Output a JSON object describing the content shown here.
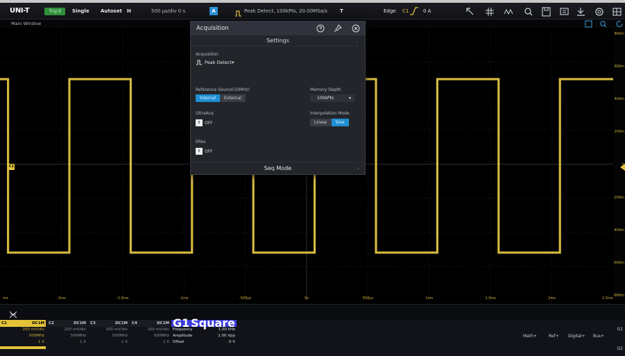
{
  "toolbar": {
    "logo": "UNI-T",
    "state": "Trig'd",
    "run_mode": "Single",
    "autoset": "Autoset",
    "horizontal_badge": "H",
    "timebase": "500 µs/div   0 s",
    "trigger_box": "A",
    "acq_summary": "Peak Detect, 100kPts, 20.00MSa/s",
    "trigger_label": "T",
    "trigger_type": "Edge",
    "trigger_source": "C1",
    "trigger_level": "0 A"
  },
  "main_window": {
    "title": "Main Window"
  },
  "waveform": {
    "channel_marker": "C1",
    "color": "#e3c33a"
  },
  "x_axis": {
    "labels": [
      "ms",
      "-2ms",
      "-1.5ms",
      "-1ms",
      "-500µs",
      "0s",
      "500µs",
      "1ms",
      "1.5ms",
      "2ms",
      "2.5ms"
    ]
  },
  "y_ruler": {
    "labels": [
      "800m",
      "600m",
      "400m",
      "200m",
      "0",
      "-200m",
      "-400m",
      "-600m",
      "-800m"
    ]
  },
  "dialog": {
    "title": "Acquisition",
    "section": "Settings",
    "acq_label": "Acquisition",
    "acq_value": "Peak Detect",
    "ref_source_label": "Reference Source(10MHz)",
    "ref_internal": "Internal",
    "ref_external": "External",
    "memory_label": "Memory Depth",
    "memory_value": "100kPts",
    "ultra_label": "UltraAcq",
    "ultra_state": "OFF",
    "interp_label": "Interpolation Mode",
    "interp_linear": "Linear",
    "interp_sine": "Sine",
    "eres_label": "ERes",
    "eres_state": "OFF",
    "seq_mode": "Seq Mode"
  },
  "channels": [
    {
      "name": "C1",
      "coupling": "DC1M",
      "scale": "200 mV/div",
      "bw": "500MHz",
      "probe": "1 X",
      "color": "#e3c33a",
      "head_bg": "#e3c33a",
      "head_fg": "#000"
    },
    {
      "name": "C2",
      "coupling": "DC1M",
      "scale": "100 mV/div",
      "bw": "500MHz",
      "probe": "1 X",
      "color": "#aab0ba",
      "head_bg": "#1a1c21",
      "head_fg": "#c8ccd4"
    },
    {
      "name": "C3",
      "coupling": "DC1M",
      "scale": "100 mV/div",
      "bw": "500MHz",
      "probe": "1 X",
      "color": "#aab0ba",
      "head_bg": "#1a1c21",
      "head_fg": "#c8ccd4"
    },
    {
      "name": "C4",
      "coupling": "DC1M",
      "scale": "100 mV/div",
      "bw": "500MHz",
      "probe": "1 X",
      "color": "#aab0ba",
      "head_bg": "#1a1c21",
      "head_fg": "#c8ccd4"
    }
  ],
  "measure": {
    "source": "G1",
    "waveform_type": "Square",
    "rows": [
      {
        "label": "Frequency",
        "value": "1.00 kHz"
      },
      {
        "label": "Amplitude",
        "value": "1.00 Vpp"
      },
      {
        "label": "Offset",
        "value": "0  V"
      }
    ]
  },
  "menu_buttons": [
    "Math+",
    "Ref+",
    "Digital+",
    "Bus+"
  ],
  "g_labels": [
    "G1",
    "G2"
  ]
}
